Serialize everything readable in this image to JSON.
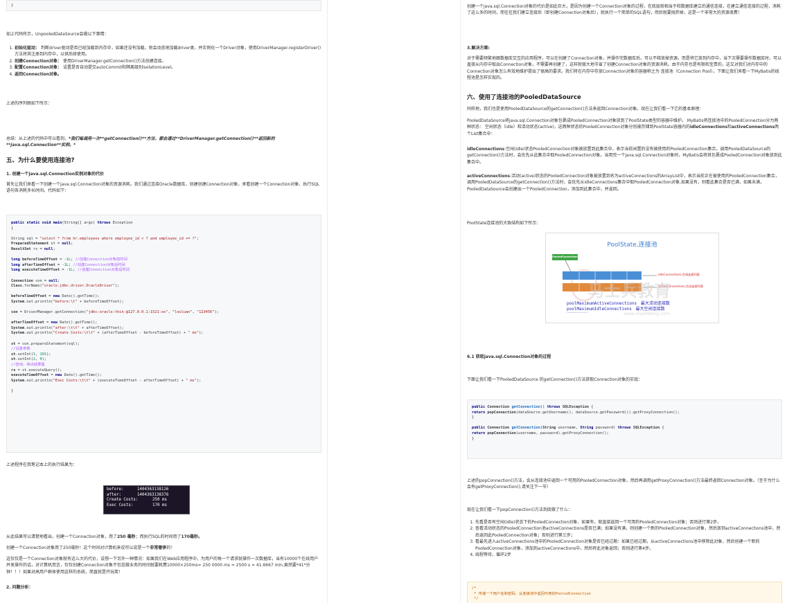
{
  "left": {
    "code_top_close": "}",
    "intro": "如上代码所示，UnpooledDataSource会做以下事情：",
    "steps": [
      {
        "bold": "初始化驱动：",
        "text": "判断driver驱动是否已经加载到内存中，如果还没有加载，则会动态地加载driver类，并实例化一个Driver对象，使用DriverManager.registerDriver()方法将其注册到内存中，以供后续使用。"
      },
      {
        "bold": "创建Connection对象：",
        "text": "使用DriverManager.getConnection()方法创建连接。"
      },
      {
        "bold": "配置Connection对象：",
        "text": "设置是否自动提交autoCommit和隔离级别isolationLevel。"
      },
      {
        "bold": "返回Connection对象。",
        "text": ""
      }
    ],
    "sequence_note": "上述的序列图如下所示：",
    "summary_prefix": "总结：从上述的代码中可以看到，",
    "summary_italic": "*我们每调用一次**getConnection()**方法，都会通过**DriverManager.getConnection()**返回新的**java.sql.Connection**实例。*",
    "h2_5": "五、为什么要使用连接池?",
    "h4_1": "1. 创建一个java.sql.Connection实例对象的代价",
    "p_cost": "首先让我们来看一下创建一个java.sql.Connection对象的资源消耗。我们通过连接Oracle数据库，创建创建Connection对象，来看创建一个Connection对象、执行SQL语句各消耗多长时间。代码如下：",
    "run_note": "上述程序在我笔记本上的执行结果为：",
    "terminal": [
      {
        "k": "before:",
        "v": "1404363138126"
      },
      {
        "k": "after:",
        "v": "1404363138376"
      },
      {
        "k": "Create Costs:",
        "v": "250 ms"
      },
      {
        "k": "Exec Costs:",
        "v": "170 ms"
      }
    ],
    "result_1_a": "从此结果可以清楚地看出，创建一个Connection对象，用了",
    "result_1_b": "250 毫秒",
    "result_1_c": "；而执行SQL的时间用了",
    "result_1_d": "170毫秒。",
    "result_2_a": "创建一个Connection对象用了250毫秒！这个时间对计算机来说可以说是一个",
    "result_2_b": "非常奢侈",
    "result_2_c": "的！",
    "result_3": "这仅仅是一个Connection对象就有这么大的代价，设想一下另外一种情况：如果我们在Web应用程序中，为用户的每一个请求就操作一次数据库，当有10000个在线用户并发操作的话，对计算机而言，仅仅创建Connection对象不包括做业务的时间就要耗费10000×250ms= 250 0000 ms = 2500 s = 41.6667 min,竟然要*41*分钟！！！如果对高用户群体使用这样的系统，简直就是开玩笑！",
    "h4_2": "2. 问题分析："
  },
  "right": {
    "p_top": "创建一个java.sql.Connection对象的代价是如此巨大，是因为创建一个Connection对象的过程，在底层就相当于和数据库建立的通信连接，在建立通信连接的过程，消耗了这么多的时间，而往往我们建立连接后（即创建Connection对象后），就执行一个简单的SQL语句，然后就要抛弃掉，这是一个非常大的资源浪费！",
    "h4_3": "3.解决方案:",
    "p_sol": "对于需要频繁地跟数据库交互的应用程序，可以在创建了Connection对象，并操作完数据库后，可以不释放掉资源，而是将它放到内存中，当下次需要操作数据库时，可以直接从内存中取出Connection对象，不需要再创建了，这样就极大地节省了创建Connection对象的资源消耗。由于内存也是有限和宝贵的，这又对我们对内存中的Connection对象怎么有效地维护提出了很高的要求。我们将在内存中存放Connection对象的容器称之为 连接池（Connection Pool）。下面让我们来看一下MyBatis的线程池是怎样实现的。",
    "h2_6": "六、使用了连接池的PooledDataSource",
    "p6_1": "同样地，我们也是使用PooledDataSource的getConnection()方法来返回Connection对象。现在让我们看一下它的基本原理：",
    "p6_2_a": "PooledDataSource将java.sql.Connection对象包裹成PooledConnection对象放到了PoolState类型的容器中维护。 MyBatis将连接池中的PooledConnection分为两种状态： 空闲状态（idle）和活动状态(active)，这两种状态的PooledConnection对象分别被存储到PoolState容器内的",
    "p6_2_b": "idleConnections",
    "p6_2_c": "和",
    "p6_2_d": "activeConnections",
    "p6_2_e": "两个List集合中：",
    "p_idle_b": "idleConnections",
    "p_idle": ":空闲(idle)状态PooledConnection对象被放置到此集合中，表示当前闲置的没有被使用的PooledConnection集合，调用PooledDataSource的getConnection()方法时，会优先从此集合中取PooledConnection对象。当用完一个java.sql.Connection对象时，MyBatis会将其包裹成PooledConnection对象放到此集合中。",
    "p_active_b": "activeConnections",
    "p_active": ":活动(active)状态的PooledConnection对象被放置到名为activeConnections的ArrayList中，表示当前正在被使用的PooledConnection集合，调用PooledDataSource的getConnection()方法时，会优先从idleConnections集合中取PooledConnection对象,如果没有，则看此集合是否已满，如果未满，PooledDataSource会创建出一个PooledConnection，添加到此集合中，并返回。",
    "p_struct": "PoolState连接池的大致结构如下所示：",
    "diagram": {
      "title": "PoolState,连接池",
      "tag": "PooledConnection",
      "idle_label": "idleConnections,空闲连接列表",
      "active_label": "activeConnections,活动连接列表",
      "line1_key": "poolMaximumActiveConnections",
      "line1_val": "最大活动连接数",
      "line2_key": "poolMaximumIdleConnections",
      "line2_val": "最大空闲连接数",
      "dots": "………………",
      "watermark_cn": "马士兵教育",
      "watermark_url": "www.mashibing.com"
    },
    "h4_61": "6.1 获取java.sql.Connection对象的过程",
    "p_get": "下面让我们看一下PooledDataSource 的getConnection()方法获取Connection对象的实现：",
    "p_after1": "上述的popConnection()方法，会从连接池中返回一个可用的PooledConnection对象，然后再调用getProxyConnection()方法最终返回Connection对象。（至于为什么会有getProxyConnection(),请关注下一节）",
    "p_after2": "现在让我们看一下popConnection()方法到底做了什么：",
    "pop_steps": [
      "先看是否有空闲(idle)状态下的PooledConnection对象，如果有，就直接返回一个可用的PooledConnection对象；否则进行第2步。",
      "查看活动状态的PooledConnection池activeConnections是否已满；如果没有满，则创建一个新的PooledConnection对象，然后放到activeConnections池中，然后返回此PooledConnection对象；否则进行第三步；",
      "看最先进入activeConnections池中的PooledConnection对象是否已经过期：如果已经过期，从activeConnections池中移除此对象，然后创建一个新的PooledConnection对象，添加到activeConnections中，然后将此对象返回；否则进行第4步。",
      "线程等待，循环2步"
    ],
    "code_bottom": [
      "/*",
      " * 传递一个用户名和密码，从连接池中返回可用的PooledConnection",
      " */"
    ]
  }
}
